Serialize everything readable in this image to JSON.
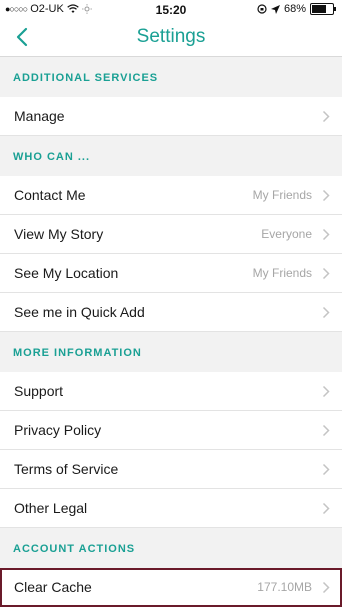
{
  "status_bar": {
    "carrier": "O2-UK",
    "time": "15:20",
    "battery": "68%",
    "battery_level": 0.68
  },
  "nav": {
    "title": "Settings",
    "back_icon": "chevron-left-icon"
  },
  "sections": [
    {
      "header": "ADDITIONAL SERVICES",
      "rows": [
        {
          "label": "Manage",
          "value": ""
        }
      ]
    },
    {
      "header": "WHO CAN ...",
      "rows": [
        {
          "label": "Contact Me",
          "value": "My Friends"
        },
        {
          "label": "View My Story",
          "value": "Everyone"
        },
        {
          "label": "See My Location",
          "value": "My Friends"
        },
        {
          "label": "See me in Quick Add",
          "value": ""
        }
      ]
    },
    {
      "header": "MORE INFORMATION",
      "rows": [
        {
          "label": "Support",
          "value": ""
        },
        {
          "label": "Privacy Policy",
          "value": ""
        },
        {
          "label": "Terms of Service",
          "value": ""
        },
        {
          "label": "Other Legal",
          "value": ""
        }
      ]
    },
    {
      "header": "ACCOUNT ACTIONS",
      "rows": [
        {
          "label": "Clear Cache",
          "value": "177.10MB"
        }
      ]
    }
  ],
  "colors": {
    "accent": "#1aa094",
    "highlight_border": "#6a1a2a"
  }
}
